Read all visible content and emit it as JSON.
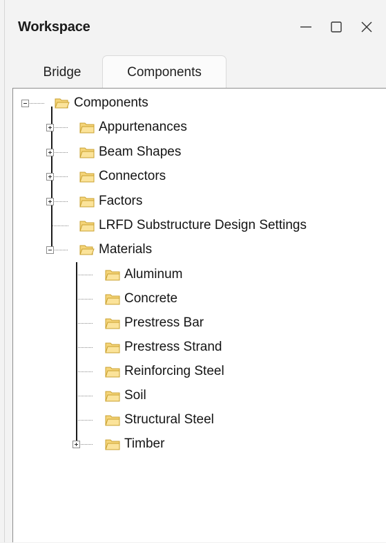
{
  "window": {
    "title": "Workspace"
  },
  "tabs": [
    {
      "label": "Bridge",
      "selected": false
    },
    {
      "label": "Components",
      "selected": true
    }
  ],
  "tree": {
    "root": {
      "label": "Components",
      "expanded": true
    },
    "level1": [
      {
        "label": "Appurtenances",
        "state": "collapsed"
      },
      {
        "label": "Beam Shapes",
        "state": "collapsed"
      },
      {
        "label": "Connectors",
        "state": "collapsed"
      },
      {
        "label": "Factors",
        "state": "collapsed"
      },
      {
        "label": "LRFD Substructure Design Settings",
        "state": "leaf"
      },
      {
        "label": "Materials",
        "state": "expanded"
      }
    ],
    "materials": [
      {
        "label": "Aluminum",
        "state": "leaf"
      },
      {
        "label": "Concrete",
        "state": "leaf"
      },
      {
        "label": "Prestress Bar",
        "state": "leaf"
      },
      {
        "label": "Prestress Strand",
        "state": "leaf"
      },
      {
        "label": "Reinforcing Steel",
        "state": "leaf"
      },
      {
        "label": "Soil",
        "state": "leaf"
      },
      {
        "label": "Structural Steel",
        "state": "leaf"
      },
      {
        "label": "Timber",
        "state": "collapsed"
      }
    ]
  },
  "colors": {
    "folder_fill": "#f5d57a",
    "folder_edge": "#c9a02f"
  }
}
